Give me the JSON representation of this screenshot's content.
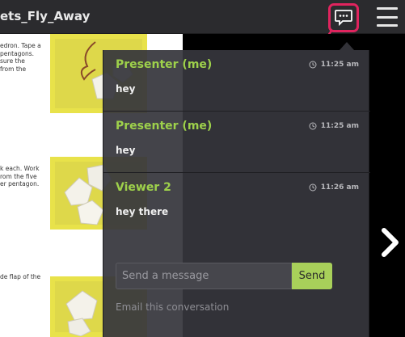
{
  "header": {
    "doc_title": "ets_Fly_Away"
  },
  "document": {
    "blocks": [
      [
        "edron. Tape a",
        "pentagons.",
        "sure the",
        "from the"
      ],
      [
        "k each. Work",
        "",
        "",
        "rom the five",
        "er pentagon."
      ],
      [
        "",
        "",
        "de flap of the"
      ]
    ]
  },
  "chat": {
    "messages": [
      {
        "sender": "Presenter (me)",
        "time": "11:25 am",
        "text": "hey"
      },
      {
        "sender": "Presenter (me)",
        "time": "11:25 am",
        "text": "hey"
      },
      {
        "sender": "Viewer 2",
        "time": "11:26 am",
        "text": "hey there"
      }
    ],
    "input_placeholder": "Send a message",
    "send_label": "Send",
    "email_label": "Email this conversation"
  },
  "colors": {
    "accent_green": "#9ed14b",
    "highlight_pink": "#e0245e",
    "send_button": "#a8d05a"
  }
}
